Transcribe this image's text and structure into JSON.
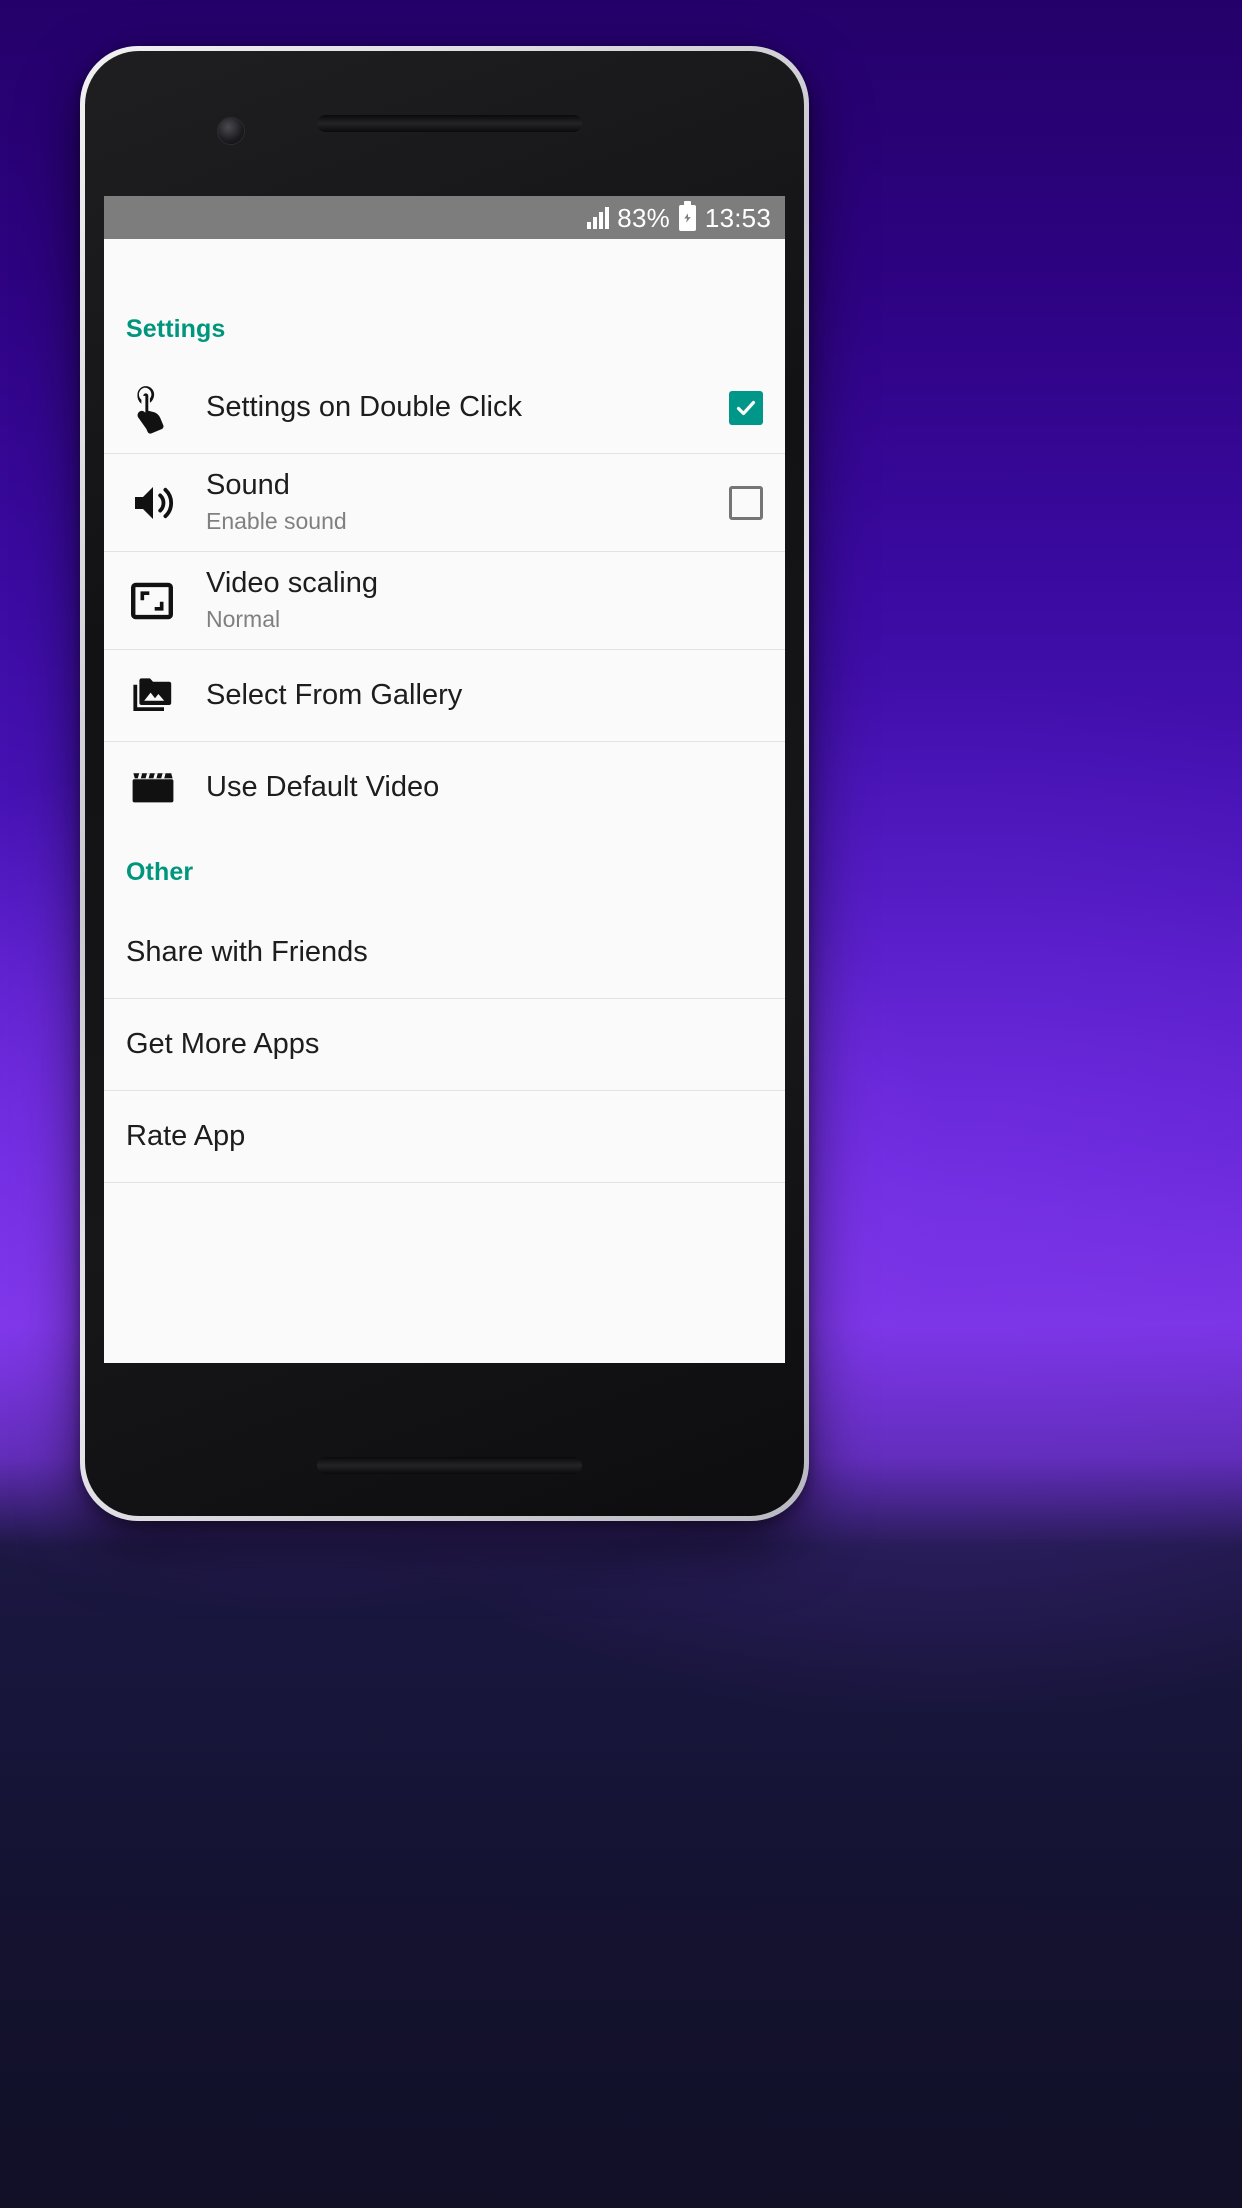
{
  "status_bar": {
    "signal_icon": "signal-bars-icon",
    "battery_percent": "83%",
    "battery_icon": "battery-charging-icon",
    "time": "13:53"
  },
  "theme": {
    "accent": "#009688",
    "section_header_color": "#00967e",
    "screen_bg": "#fafafa",
    "status_bar_bg": "#7d7d7d"
  },
  "sections": [
    {
      "header": "Settings",
      "rows": [
        {
          "icon": "touch-tap-icon",
          "title": "Settings on Double Click",
          "subtitle": "",
          "control": "checkbox",
          "checked": true
        },
        {
          "icon": "volume-up-icon",
          "title": "Sound",
          "subtitle": "Enable sound",
          "control": "checkbox",
          "checked": false
        },
        {
          "icon": "fit-screen-icon",
          "title": "Video scaling",
          "subtitle": "Normal",
          "control": "none",
          "checked": false
        },
        {
          "icon": "photo-library-icon",
          "title": "Select From Gallery",
          "subtitle": "",
          "control": "none",
          "checked": false
        },
        {
          "icon": "movie-clapper-icon",
          "title": "Use Default Video",
          "subtitle": "",
          "control": "none",
          "checked": false
        }
      ]
    },
    {
      "header": "Other",
      "rows": [
        {
          "icon": "none",
          "title": "Share with Friends",
          "subtitle": "",
          "control": "none",
          "checked": false
        },
        {
          "icon": "none",
          "title": "Get More Apps",
          "subtitle": "",
          "control": "none",
          "checked": false
        },
        {
          "icon": "none",
          "title": "Rate App",
          "subtitle": "",
          "control": "none",
          "checked": false
        }
      ]
    }
  ]
}
